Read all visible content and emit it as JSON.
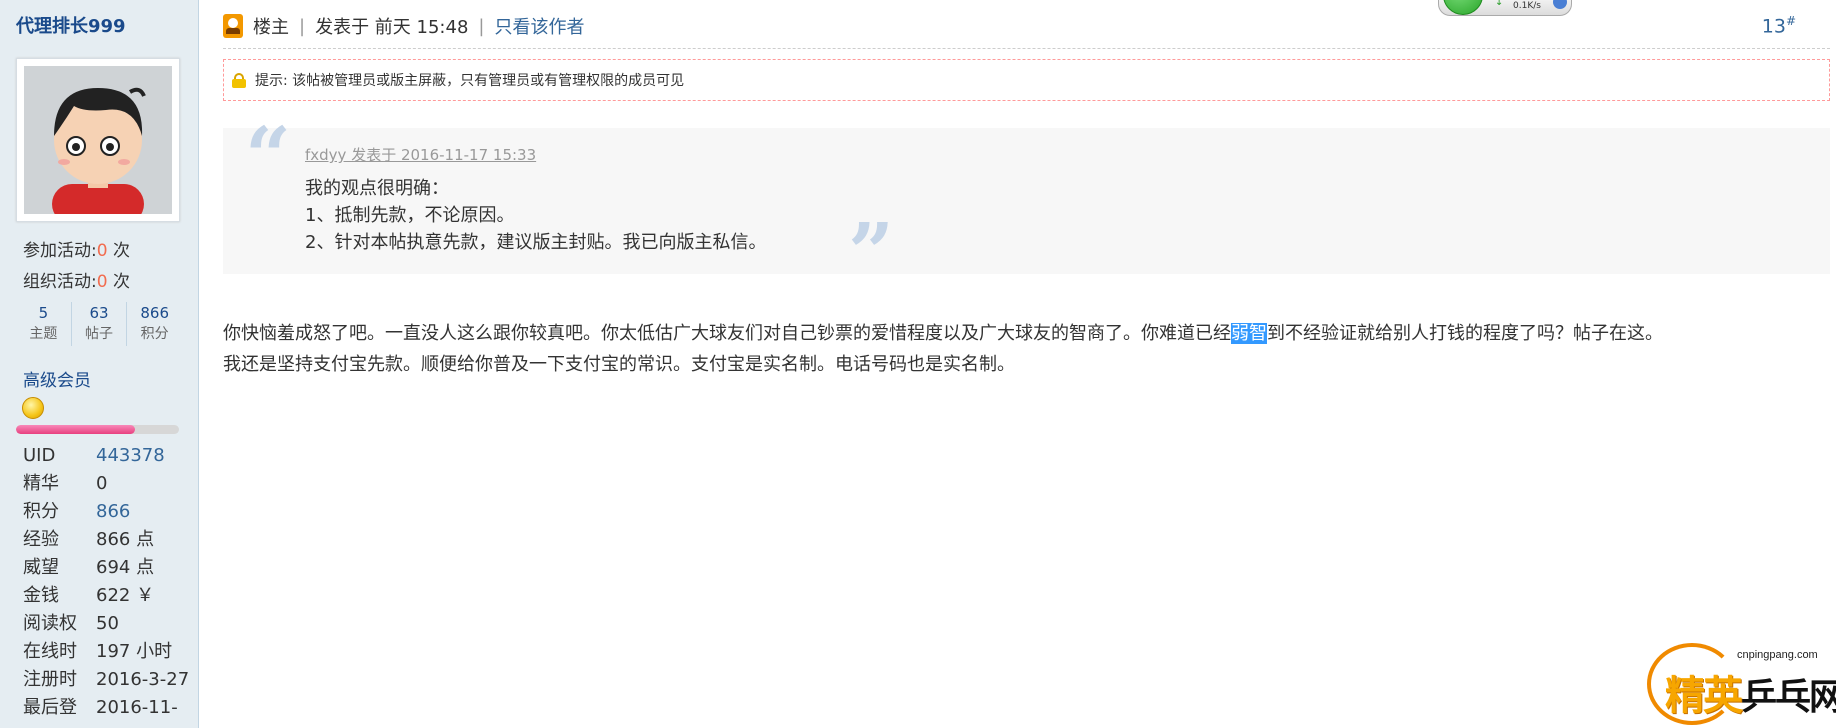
{
  "sidebar": {
    "username": "代理排长999",
    "stats": {
      "activity_join_label": "参加活动:",
      "activity_join_value": "0",
      "activity_join_unit": " 次",
      "activity_org_label": "组织活动:",
      "activity_org_value": "0",
      "activity_org_unit": " 次"
    },
    "counts": [
      {
        "value": "5",
        "label": "主题"
      },
      {
        "value": "63",
        "label": "帖子"
      },
      {
        "value": "866",
        "label": "积分"
      }
    ],
    "group": "高级会员",
    "level_progress_percent": 73,
    "info": [
      {
        "key": "UID",
        "value": "443378"
      },
      {
        "key": "精华",
        "value": "0"
      },
      {
        "key": "积分",
        "value": "866"
      },
      {
        "key": "经验",
        "value": "866 点"
      },
      {
        "key": "威望",
        "value": "694 点"
      },
      {
        "key": "金钱",
        "value": "622 ￥"
      },
      {
        "key": "阅读权",
        "value": "50"
      },
      {
        "key": "在线时",
        "value": "197 小时"
      },
      {
        "key": "注册时",
        "value": "2016-3-27"
      },
      {
        "key": "最后登",
        "value": "2016-11-"
      }
    ]
  },
  "post": {
    "owner_label": "楼主",
    "posted_at": "发表于 前天 15:48",
    "only_author_link": "只看该作者",
    "floor_number": "13",
    "floor_suffix": "#",
    "notice": "提示: 该帖被管理员或版主屏蔽，只有管理员或有管理权限的成员可见",
    "quote": {
      "by": "fxdyy 发表于 2016-11-17 15:33",
      "lines": [
        "我的观点很明确：",
        "1、抵制先款，不论原因。",
        "2、针对本帖执意先款，建议版主封贴。我已向版主私信。"
      ]
    },
    "reply": {
      "line1_before": "你快恼羞成怒了吧。一直没人这么跟你较真吧。你太低估广大球友们对自己钞票的爱惜程度以及广大球友的智商了。你难道已经",
      "line1_selected": "弱智",
      "line1_after": "到不经验证就给别人打钱的程度了吗？帖子在这。",
      "line2": "我还是坚持支付宝先款。顺便给你普及一下支付宝的常识。支付宝是实名制。电话号码也是实名制。"
    }
  },
  "overlay": {
    "speed_rate": "0.1K/s",
    "watermark_url": "cnpingpang.com",
    "watermark_brand_1": "精英",
    "watermark_brand_2": "乒乓网"
  },
  "colors": {
    "sidebar_bg": "#e5edf2",
    "link": "#336699",
    "highlight_number": "#f26c4f",
    "selection": "#3399ff",
    "owner_icon": "#f39800",
    "watermark_orange": "#f7a600"
  }
}
